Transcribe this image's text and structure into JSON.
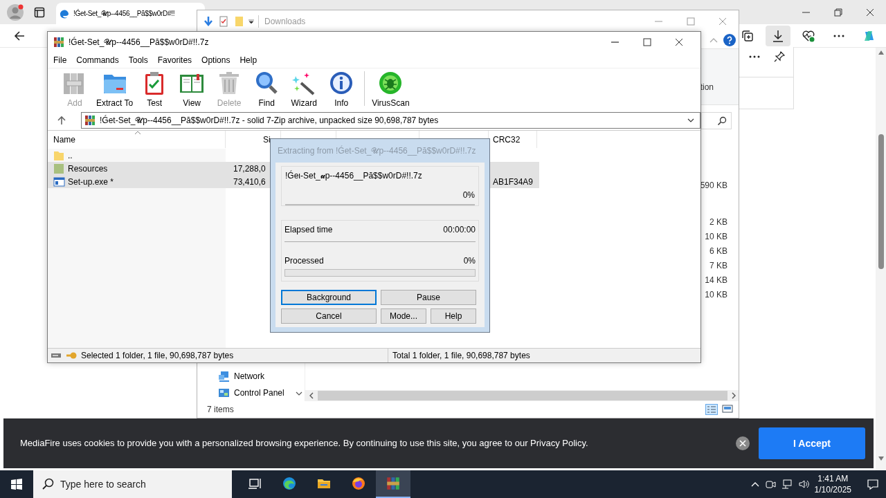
{
  "browser": {
    "tab": {
      "title": "!Ǵet-Set_𝓤p--4456__Pă$$w0rD#!!",
      "selected": true
    }
  },
  "explorer": {
    "title": "Downloads",
    "ribbon_text": "tion",
    "sizes": [
      "590 KB",
      "2 KB",
      "10 KB",
      "6 KB",
      "7 KB",
      "14 KB",
      "10 KB"
    ],
    "nav": [
      {
        "label": "Network",
        "kind": "network"
      },
      {
        "label": "Control Panel",
        "kind": "control"
      }
    ],
    "status": "7 items"
  },
  "winrar": {
    "title": "!Ǵet-Set_𝓤p--4456__Pă$$w0rD#!!.7z",
    "menu": [
      "File",
      "Commands",
      "Tools",
      "Favorites",
      "Options",
      "Help"
    ],
    "toolbar_groups": [
      [
        {
          "label": "Add",
          "kind": "add",
          "disabled": true
        },
        {
          "label": "Extract To",
          "kind": "extract",
          "disabled": false
        },
        {
          "label": "Test",
          "kind": "test",
          "disabled": false
        },
        {
          "label": "View",
          "kind": "view",
          "disabled": false
        },
        {
          "label": "Delete",
          "kind": "delete",
          "disabled": true
        },
        {
          "label": "Find",
          "kind": "find",
          "disabled": false
        },
        {
          "label": "Wizard",
          "kind": "wizard",
          "disabled": false
        },
        {
          "label": "Info",
          "kind": "info",
          "disabled": false
        }
      ],
      [
        {
          "label": "VirusScan",
          "kind": "scan",
          "disabled": false
        }
      ]
    ],
    "address": "!Ǵet-Set_𝓤p--4456__Pă$$w0rD#!!.7z - solid 7-Zip archive, unpacked size 90,698,787 bytes",
    "columns": [
      "Name",
      "Si",
      "CRC32"
    ],
    "rows": [
      {
        "name": "..",
        "size": "",
        "crc": "",
        "kind": "up",
        "selected": false
      },
      {
        "name": "Resources",
        "size": "17,288,0",
        "crc": "",
        "kind": "folder",
        "selected": true
      },
      {
        "name": "Set-up.exe *",
        "size": "73,410,6",
        "crc": "AB1F34A9",
        "kind": "exe",
        "selected": true
      }
    ],
    "status_left": "Selected 1 folder, 1 file, 90,698,787 bytes",
    "status_right": "Total 1 folder, 1 file, 90,698,787 bytes"
  },
  "dialog": {
    "title": "Extracting from !Ǵet-Set_𝓤p--4456__Pă$$w0rD#!!.7z",
    "archive": "!Ǵeι-Set_𝓾p--4456__Pă$$w0rD#!!.7z",
    "percent": "0%",
    "progress": {
      "level": 0
    },
    "elapsed_label": "Elapsed time",
    "elapsed": "00:00:00",
    "processed_label": "Processed",
    "processed": "0%",
    "processed_progress": {
      "level": 0
    },
    "buttons": [
      {
        "label": "Background",
        "focused": true
      },
      {
        "label": "Pause",
        "focused": false
      },
      {
        "label": "Cancel",
        "focused": false
      },
      {
        "label": "Mode...",
        "focused": false
      },
      {
        "label": "Help",
        "focused": false
      }
    ]
  },
  "cookie": {
    "text": "MediaFire uses cookies to provide you with a personalized browsing experience. By continuing to use this site, you agree to our Privacy Policy.",
    "button": "I Accept"
  },
  "taskbar": {
    "search_placeholder": "Type here to search",
    "apps": [
      {
        "kind": "taskview",
        "active": false
      },
      {
        "kind": "edge",
        "active": false
      },
      {
        "kind": "files",
        "active": false
      },
      {
        "kind": "firefox",
        "active": false
      },
      {
        "kind": "winrar",
        "active": true
      }
    ],
    "time": "1:41 AM",
    "date": "1/10/2025"
  }
}
